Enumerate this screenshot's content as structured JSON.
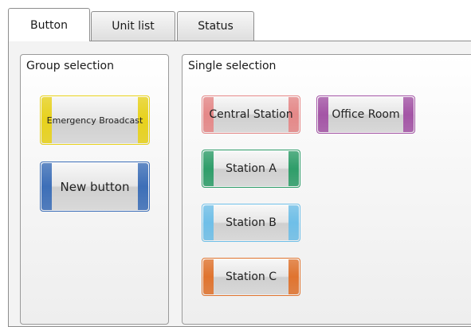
{
  "tabs": [
    {
      "label": "Button",
      "active": true
    },
    {
      "label": "Unit list",
      "active": false
    },
    {
      "label": "Status",
      "active": false
    }
  ],
  "group_panel": {
    "title": "Group selection",
    "buttons": [
      {
        "label": "Emergency Broadcast",
        "color": "#e8d21c"
      },
      {
        "label": "New button",
        "color": "#3d6fb8"
      }
    ]
  },
  "single_panel": {
    "title": "Single selection",
    "buttons": [
      {
        "label": "Central Station",
        "color": "#e58888"
      },
      {
        "label": "Office Room",
        "color": "#a455a6"
      },
      {
        "label": "Station A",
        "color": "#2f9e6a"
      },
      {
        "label": "Station B",
        "color": "#6fbfe8"
      },
      {
        "label": "Station C",
        "color": "#e0742f"
      }
    ]
  }
}
